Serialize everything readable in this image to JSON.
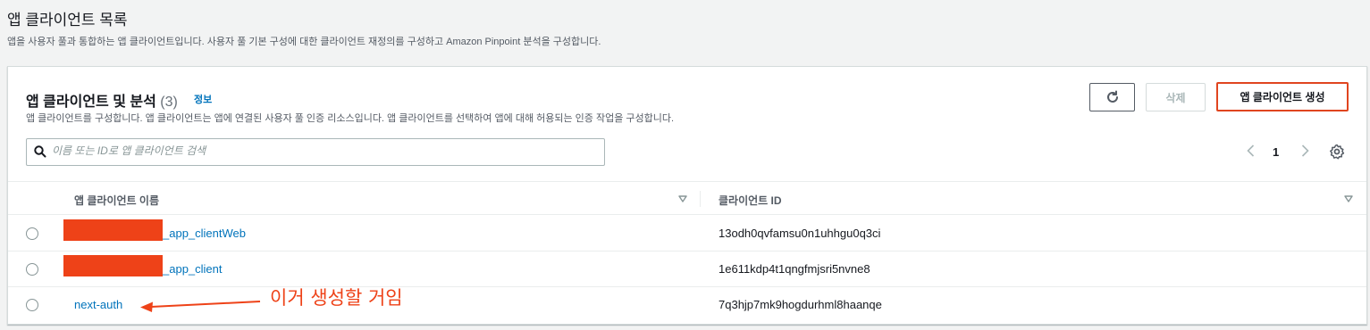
{
  "page": {
    "title": "앱 클라이언트 목록",
    "description": "앱을 사용자 풀과 통합하는 앱 클라이언트입니다. 사용자 풀 기본 구성에 대한 클라이언트 재정의를 구성하고 Amazon Pinpoint 분석을 구성합니다."
  },
  "panel": {
    "title": "앱 클라이언트 및 분석",
    "count": "(3)",
    "info_label": "정보",
    "description": "앱 클라이언트를 구성합니다. 앱 클라이언트는 앱에 연결된 사용자 풀 인증 리소스입니다. 앱 클라이언트를 선택하여 앱에 대해 허용되는 인증 작업을 구성합니다.",
    "buttons": {
      "delete_label": "삭제",
      "create_label": "앱 클라이언트 생성"
    },
    "search": {
      "placeholder": "이름 또는 ID로 앱 클라이언트 검색"
    },
    "pagination": {
      "current_page": "1"
    },
    "table": {
      "columns": [
        "앱 클라이언트 이름",
        "클라이언트 ID"
      ],
      "rows": [
        {
          "name": "_app_clientWeb",
          "client_id": "13odh0qvfamsu0n1uhhgu0q3ci"
        },
        {
          "name": "_app_client",
          "client_id": "1e611kdp4t1qngfmjsri5nvne8"
        },
        {
          "name": "next-auth",
          "client_id": "7q3hjp7mk9hogdurhml8haanqe"
        }
      ]
    }
  },
  "annotation": {
    "text": "이거 생성할 거임"
  },
  "colors": {
    "link": "#0073bb",
    "annotation": "#ee4218",
    "redaction": "#ee4218"
  },
  "icons": [
    "refresh-icon",
    "search-icon",
    "chevron-left-icon",
    "chevron-right-icon",
    "settings-icon",
    "sort-down-icon"
  ]
}
